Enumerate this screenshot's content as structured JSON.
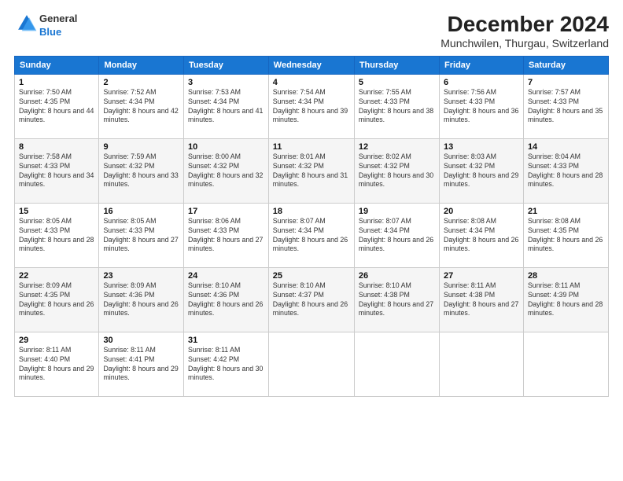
{
  "header": {
    "logo": {
      "line1": "General",
      "line2": "Blue"
    },
    "title": "December 2024",
    "subtitle": "Munchwilen, Thurgau, Switzerland"
  },
  "calendar": {
    "weekdays": [
      "Sunday",
      "Monday",
      "Tuesday",
      "Wednesday",
      "Thursday",
      "Friday",
      "Saturday"
    ],
    "weeks": [
      [
        {
          "day": "1",
          "sunrise": "7:50 AM",
          "sunset": "4:35 PM",
          "daylight": "8 hours and 44 minutes."
        },
        {
          "day": "2",
          "sunrise": "7:52 AM",
          "sunset": "4:34 PM",
          "daylight": "8 hours and 42 minutes."
        },
        {
          "day": "3",
          "sunrise": "7:53 AM",
          "sunset": "4:34 PM",
          "daylight": "8 hours and 41 minutes."
        },
        {
          "day": "4",
          "sunrise": "7:54 AM",
          "sunset": "4:34 PM",
          "daylight": "8 hours and 39 minutes."
        },
        {
          "day": "5",
          "sunrise": "7:55 AM",
          "sunset": "4:33 PM",
          "daylight": "8 hours and 38 minutes."
        },
        {
          "day": "6",
          "sunrise": "7:56 AM",
          "sunset": "4:33 PM",
          "daylight": "8 hours and 36 minutes."
        },
        {
          "day": "7",
          "sunrise": "7:57 AM",
          "sunset": "4:33 PM",
          "daylight": "8 hours and 35 minutes."
        }
      ],
      [
        {
          "day": "8",
          "sunrise": "7:58 AM",
          "sunset": "4:33 PM",
          "daylight": "8 hours and 34 minutes."
        },
        {
          "day": "9",
          "sunrise": "7:59 AM",
          "sunset": "4:32 PM",
          "daylight": "8 hours and 33 minutes."
        },
        {
          "day": "10",
          "sunrise": "8:00 AM",
          "sunset": "4:32 PM",
          "daylight": "8 hours and 32 minutes."
        },
        {
          "day": "11",
          "sunrise": "8:01 AM",
          "sunset": "4:32 PM",
          "daylight": "8 hours and 31 minutes."
        },
        {
          "day": "12",
          "sunrise": "8:02 AM",
          "sunset": "4:32 PM",
          "daylight": "8 hours and 30 minutes."
        },
        {
          "day": "13",
          "sunrise": "8:03 AM",
          "sunset": "4:32 PM",
          "daylight": "8 hours and 29 minutes."
        },
        {
          "day": "14",
          "sunrise": "8:04 AM",
          "sunset": "4:33 PM",
          "daylight": "8 hours and 28 minutes."
        }
      ],
      [
        {
          "day": "15",
          "sunrise": "8:05 AM",
          "sunset": "4:33 PM",
          "daylight": "8 hours and 28 minutes."
        },
        {
          "day": "16",
          "sunrise": "8:05 AM",
          "sunset": "4:33 PM",
          "daylight": "8 hours and 27 minutes."
        },
        {
          "day": "17",
          "sunrise": "8:06 AM",
          "sunset": "4:33 PM",
          "daylight": "8 hours and 27 minutes."
        },
        {
          "day": "18",
          "sunrise": "8:07 AM",
          "sunset": "4:34 PM",
          "daylight": "8 hours and 26 minutes."
        },
        {
          "day": "19",
          "sunrise": "8:07 AM",
          "sunset": "4:34 PM",
          "daylight": "8 hours and 26 minutes."
        },
        {
          "day": "20",
          "sunrise": "8:08 AM",
          "sunset": "4:34 PM",
          "daylight": "8 hours and 26 minutes."
        },
        {
          "day": "21",
          "sunrise": "8:08 AM",
          "sunset": "4:35 PM",
          "daylight": "8 hours and 26 minutes."
        }
      ],
      [
        {
          "day": "22",
          "sunrise": "8:09 AM",
          "sunset": "4:35 PM",
          "daylight": "8 hours and 26 minutes."
        },
        {
          "day": "23",
          "sunrise": "8:09 AM",
          "sunset": "4:36 PM",
          "daylight": "8 hours and 26 minutes."
        },
        {
          "day": "24",
          "sunrise": "8:10 AM",
          "sunset": "4:36 PM",
          "daylight": "8 hours and 26 minutes."
        },
        {
          "day": "25",
          "sunrise": "8:10 AM",
          "sunset": "4:37 PM",
          "daylight": "8 hours and 26 minutes."
        },
        {
          "day": "26",
          "sunrise": "8:10 AM",
          "sunset": "4:38 PM",
          "daylight": "8 hours and 27 minutes."
        },
        {
          "day": "27",
          "sunrise": "8:11 AM",
          "sunset": "4:38 PM",
          "daylight": "8 hours and 27 minutes."
        },
        {
          "day": "28",
          "sunrise": "8:11 AM",
          "sunset": "4:39 PM",
          "daylight": "8 hours and 28 minutes."
        }
      ],
      [
        {
          "day": "29",
          "sunrise": "8:11 AM",
          "sunset": "4:40 PM",
          "daylight": "8 hours and 29 minutes."
        },
        {
          "day": "30",
          "sunrise": "8:11 AM",
          "sunset": "4:41 PM",
          "daylight": "8 hours and 29 minutes."
        },
        {
          "day": "31",
          "sunrise": "8:11 AM",
          "sunset": "4:42 PM",
          "daylight": "8 hours and 30 minutes."
        },
        null,
        null,
        null,
        null
      ]
    ]
  }
}
